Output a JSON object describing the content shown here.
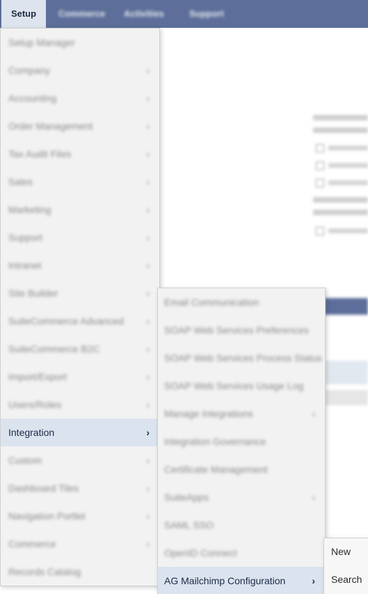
{
  "nav": {
    "tabs": [
      {
        "label": "Setup",
        "active": true
      },
      {
        "label": "Commerce",
        "active": false
      },
      {
        "label": "Activities",
        "active": false
      },
      {
        "label": "Support",
        "active": false
      }
    ]
  },
  "setup_menu": {
    "items": [
      {
        "label": "Setup Manager",
        "has_submenu": false
      },
      {
        "label": "Company",
        "has_submenu": true
      },
      {
        "label": "Accounting",
        "has_submenu": true
      },
      {
        "label": "Order Management",
        "has_submenu": true
      },
      {
        "label": "Tax Audit Files",
        "has_submenu": true
      },
      {
        "label": "Sales",
        "has_submenu": true
      },
      {
        "label": "Marketing",
        "has_submenu": true
      },
      {
        "label": "Support",
        "has_submenu": true
      },
      {
        "label": "Intranet",
        "has_submenu": true
      },
      {
        "label": "Site Builder",
        "has_submenu": true
      },
      {
        "label": "SuiteCommerce Advanced",
        "has_submenu": true
      },
      {
        "label": "SuiteCommerce B2C",
        "has_submenu": true
      },
      {
        "label": "Import/Export",
        "has_submenu": true
      },
      {
        "label": "Users/Roles",
        "has_submenu": true
      },
      {
        "label": "Integration",
        "has_submenu": true,
        "active": true
      },
      {
        "label": "Custom",
        "has_submenu": true
      },
      {
        "label": "Dashboard Tiles",
        "has_submenu": true
      },
      {
        "label": "Navigation Portlet",
        "has_submenu": true
      },
      {
        "label": "Commerce",
        "has_submenu": true
      },
      {
        "label": "Records Catalog",
        "has_submenu": false
      }
    ]
  },
  "integration_menu": {
    "items": [
      {
        "label": "Email Communication",
        "has_submenu": false
      },
      {
        "label": "SOAP Web Services Preferences",
        "has_submenu": false
      },
      {
        "label": "SOAP Web Services Process Status",
        "has_submenu": false
      },
      {
        "label": "SOAP Web Services Usage Log",
        "has_submenu": false
      },
      {
        "label": "Manage Integrations",
        "has_submenu": true
      },
      {
        "label": "Integration Governance",
        "has_submenu": false
      },
      {
        "label": "Certificate Management",
        "has_submenu": false
      },
      {
        "label": "SuiteApps",
        "has_submenu": true
      },
      {
        "label": "SAML SSO",
        "has_submenu": false
      },
      {
        "label": "OpenID Connect",
        "has_submenu": false
      },
      {
        "label": "AG Mailchimp Configuration",
        "has_submenu": true,
        "active": true
      }
    ]
  },
  "mailchimp_menu": {
    "items": [
      {
        "label": "New"
      },
      {
        "label": "Search"
      }
    ]
  },
  "colors": {
    "nav_bg": "#5c6e99",
    "active_item_bg": "#dbe3ee",
    "menu_bg": "#f2f2f2"
  }
}
